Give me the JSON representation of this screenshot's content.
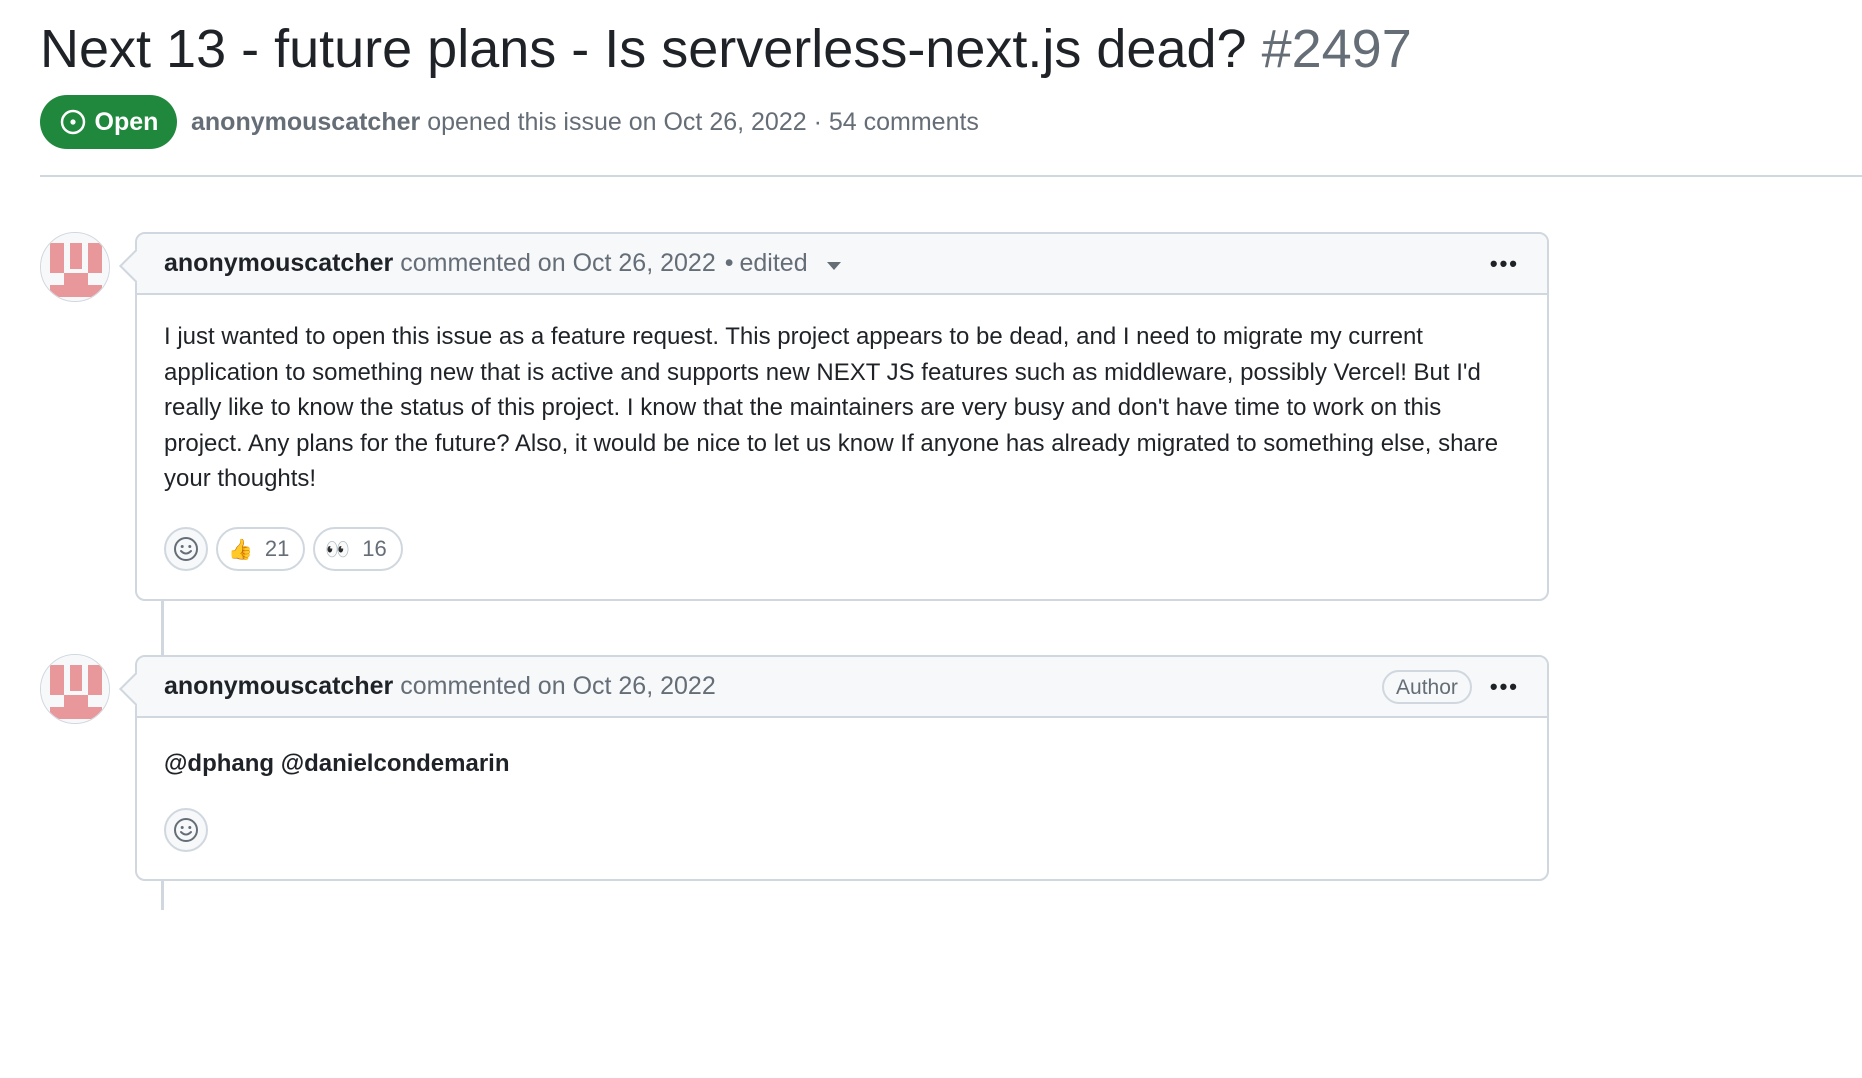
{
  "issue": {
    "title": "Next 13 - future plans - Is serverless-next.js dead?",
    "number": "#2497",
    "state": "Open",
    "author": "anonymouscatcher",
    "meta_suffix": "opened this issue on Oct 26, 2022 · 54 comments"
  },
  "comments": [
    {
      "author": "anonymouscatcher",
      "action": "commented on Oct 26, 2022",
      "separator": "•",
      "edited_label": "edited",
      "body": "I just wanted to open this issue as a feature request. This project appears to be dead, and I need to migrate my current application to something new that is active and supports new NEXT JS features such as middleware, possibly Vercel! But I'd really like to know the status of this project. I know that the maintainers are very busy and don't have time to work on this project. Any plans for the future? Also, it would be nice to let us know If anyone has already migrated to something else, share your thoughts!",
      "reactions": [
        {
          "emoji": "👍",
          "count": "21"
        },
        {
          "emoji": "👀",
          "count": "16"
        }
      ]
    },
    {
      "author": "anonymouscatcher",
      "action": "commented on Oct 26, 2022",
      "badge": "Author",
      "body": "@dphang @danielcondemarin"
    }
  ],
  "icons": {
    "more": "kebab-horizontal-icon",
    "add_reaction": "smiley-icon",
    "state": "issue-open-icon"
  },
  "colors": {
    "open_green": "#1f883d",
    "muted": "#656d76",
    "border": "#d0d7de",
    "header_bg": "#f6f8fa",
    "avatar_pink": "#e8989a"
  }
}
